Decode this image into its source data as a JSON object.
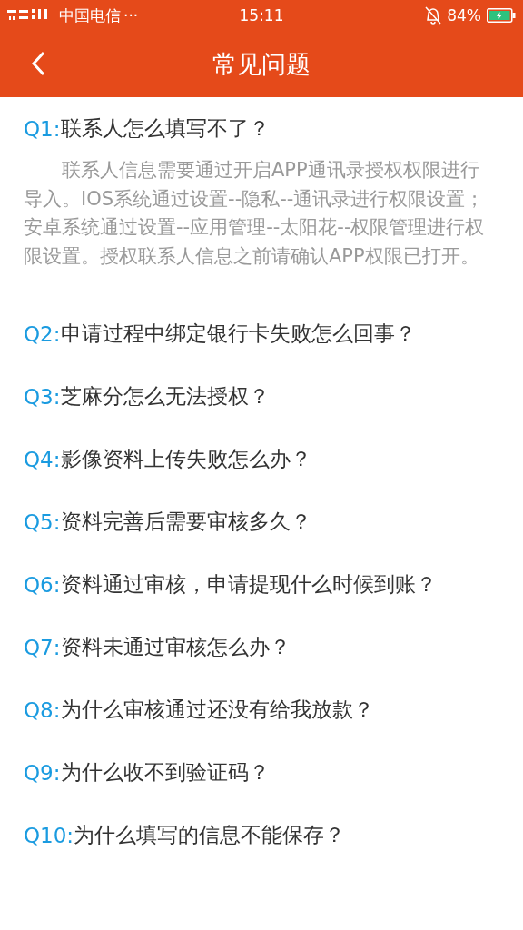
{
  "status_bar": {
    "carrier": "中国电信",
    "more": "···",
    "time": "15:11",
    "battery": "84%"
  },
  "header": {
    "title": "常见问题"
  },
  "questions": [
    {
      "number": "Q1:",
      "text": "联系人怎么填写不了？",
      "answer": "联系人信息需要通过开启APP通讯录授权权限进行导入。IOS系统通过设置--隐私--通讯录进行权限设置；安卓系统通过设置--应用管理--太阳花--权限管理进行权限设置。授权联系人信息之前请确认APP权限已打开。"
    },
    {
      "number": "Q2:",
      "text": "申请过程中绑定银行卡失败怎么回事？"
    },
    {
      "number": "Q3:",
      "text": "芝麻分怎么无法授权？"
    },
    {
      "number": "Q4:",
      "text": "影像资料上传失败怎么办？"
    },
    {
      "number": "Q5:",
      "text": "资料完善后需要审核多久？"
    },
    {
      "number": "Q6:",
      "text": "资料通过审核，申请提现什么时候到账？"
    },
    {
      "number": "Q7:",
      "text": "资料未通过审核怎么办？"
    },
    {
      "number": "Q8:",
      "text": "为什么审核通过还没有给我放款？"
    },
    {
      "number": "Q9:",
      "text": "为什么收不到验证码？"
    },
    {
      "number": "Q10:",
      "text": "为什么填写的信息不能保存？"
    }
  ]
}
